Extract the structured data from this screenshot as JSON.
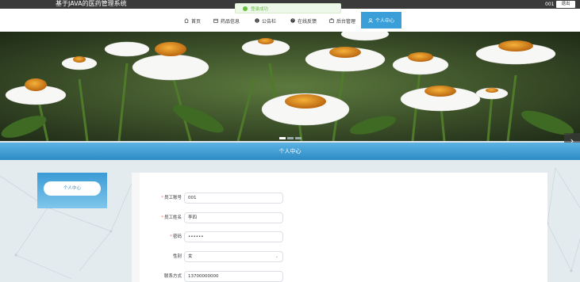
{
  "header": {
    "site_title": "基于JAVA的医药管理系统",
    "user_id": "001",
    "logout_label": "退出"
  },
  "toast": {
    "message": "登录成功"
  },
  "nav": {
    "items": [
      {
        "label": "首页",
        "icon": "home-icon"
      },
      {
        "label": "药品信息",
        "icon": "box-icon"
      },
      {
        "label": "公告栏",
        "icon": "info-icon"
      },
      {
        "label": "在线反馈",
        "icon": "question-icon"
      },
      {
        "label": "后台管理",
        "icon": "briefcase-icon"
      }
    ],
    "active_label": "个人中心",
    "active_icon": "user-icon"
  },
  "section": {
    "title": "个人中心"
  },
  "sidebar": {
    "button_label": "个人中心"
  },
  "form": {
    "fields": [
      {
        "label": "员工账号",
        "value": "001",
        "required": true
      },
      {
        "label": "员工姓名",
        "value": "李四",
        "required": true
      },
      {
        "label": "密码",
        "value": "••••••",
        "required": true
      },
      {
        "label": "性别",
        "value": "女",
        "required": false
      },
      {
        "label": "联系方式",
        "value": "13700000000",
        "required": false
      }
    ]
  },
  "colors": {
    "accent": "#3a9fd8",
    "topbar": "#3a3a3a",
    "success": "#67c23a",
    "required": "#f56c6c"
  }
}
